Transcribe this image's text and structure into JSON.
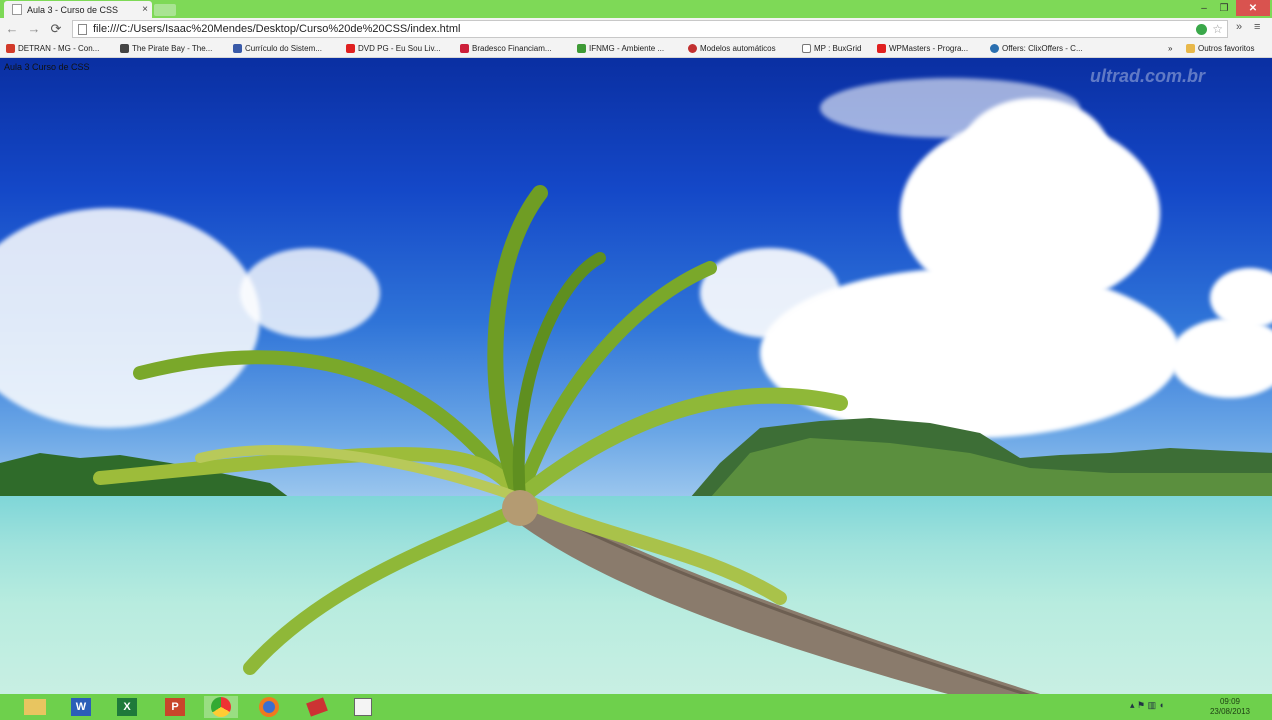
{
  "browser": {
    "tab_title": "Aula 3 - Curso de CSS",
    "tab_close": "×",
    "url": "file:///C:/Users/Isaac%20Mendes/Desktop/Curso%20de%20CSS/index.html",
    "window_min": "–",
    "window_max": "❐",
    "window_close": "✕",
    "overflow": "»"
  },
  "bookmarks": [
    {
      "label": "DETRAN - MG - Con...",
      "color": "#d23a2a"
    },
    {
      "label": "The Pirate Bay - The...",
      "color": "#444444"
    },
    {
      "label": "Currículo do Sistem...",
      "color": "#3a5aa8"
    },
    {
      "label": "DVD PG - Eu Sou Liv...",
      "color": "#e02020"
    },
    {
      "label": "Bradesco Financiam...",
      "color": "#cc1f3a"
    },
    {
      "label": "IFNMG - Ambiente ...",
      "color": "#3e9a36"
    },
    {
      "label": "Modelos automáticos",
      "color": "#c23030"
    },
    {
      "label": "MP : BuxGrid",
      "color": "#777777"
    },
    {
      "label": "WPMasters - Progra...",
      "color": "#e02020"
    },
    {
      "label": "Offers: ClixOffers - C...",
      "color": "#2a6fb0"
    }
  ],
  "bookmarks_other": "Outros favoritos",
  "page": {
    "watermark": "ultrad.com.br",
    "top_text": "Aula 3 Curso de CSS"
  },
  "taskbar": {
    "apps": [
      "explorer",
      "word",
      "excel",
      "powerpoint",
      "chrome",
      "firefox",
      "app-red",
      "paint"
    ],
    "time": "09:09",
    "date": "23/08/2013"
  }
}
